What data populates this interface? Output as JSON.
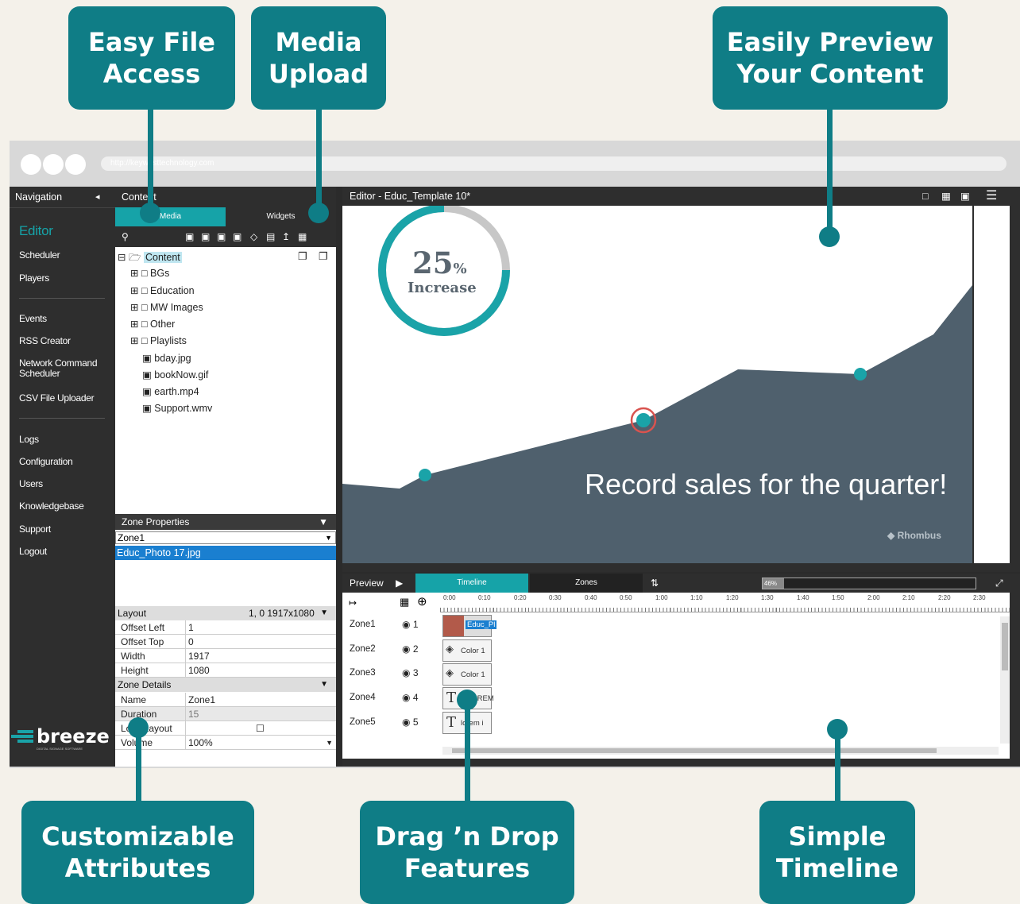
{
  "callouts": {
    "easy_file": "Easy File\nAccess",
    "media_upload": "Media\nUpload",
    "preview": "Easily Preview\nYour Content",
    "custom": "Customizable\nAttributes",
    "drag": "Drag ’n Drop\nFeatures",
    "timeline": "Simple\nTimeline"
  },
  "browser": {
    "url": "http://keywesttechnology.com"
  },
  "nav": {
    "title": "Navigation",
    "collapse": "◂",
    "items": [
      "Editor",
      "Scheduler",
      "Players",
      "Events",
      "RSS Creator",
      "Network Command Scheduler",
      "CSV File Uploader",
      "Logs",
      "Configuration",
      "Users",
      "Knowledgebase",
      "Support",
      "Logout"
    ],
    "logo": "breeze",
    "logo_sub": "DIGITAL SIGNAGE SOFTWARE"
  },
  "content": {
    "title": "Content",
    "tabs": [
      "Media",
      "Widgets"
    ],
    "tree": [
      {
        "label": "Content",
        "type": "root"
      },
      {
        "label": "BGs",
        "type": "folder"
      },
      {
        "label": "Education",
        "type": "folder"
      },
      {
        "label": "MW Images",
        "type": "folder"
      },
      {
        "label": "Other",
        "type": "folder"
      },
      {
        "label": "Playlists",
        "type": "folder"
      },
      {
        "label": "bday.jpg",
        "type": "file"
      },
      {
        "label": "bookNow.gif",
        "type": "file"
      },
      {
        "label": "earth.mp4",
        "type": "file"
      },
      {
        "label": "Support.wmv",
        "type": "file"
      }
    ],
    "zone_properties": "Zone Properties",
    "zone_select": "Zone1",
    "zone_file": "Educ_Photo 17.jpg",
    "layout_label": "Layout",
    "layout_info": "1, 0  1917x1080",
    "layout_rows": [
      {
        "k": "Offset Left",
        "v": "1"
      },
      {
        "k": "Offset Top",
        "v": "0"
      },
      {
        "k": "Width",
        "v": "1917"
      },
      {
        "k": "Height",
        "v": "1080"
      }
    ],
    "zone_details_label": "Zone Details",
    "zone_rows": [
      {
        "k": "Name",
        "v": "Zone1"
      },
      {
        "k": "Duration",
        "v": "15"
      },
      {
        "k": "Lock Layout",
        "v": "☐"
      },
      {
        "k": "Volume",
        "v": "100%"
      }
    ]
  },
  "editor": {
    "title": "Editor - Educ_Template 10*",
    "percent_num": "25",
    "percent_sign": "%",
    "increase": "Increase",
    "record": "Record sales for the quarter!",
    "brand": "Rhombus"
  },
  "timeline": {
    "preview": "Preview",
    "tab_timeline": "Timeline",
    "tab_zones": "Zones",
    "zoom": "46%",
    "ticks": [
      "0:00",
      "0:10",
      "0:20",
      "0:30",
      "0:40",
      "0:50",
      "1:00",
      "1:10",
      "1:20",
      "1:30",
      "1:40",
      "1:50",
      "2:00",
      "2:10",
      "2:20",
      "2:30"
    ],
    "zones": [
      {
        "name": "Zone1",
        "num": "1",
        "clip": "Educ_Pl"
      },
      {
        "name": "Zone2",
        "num": "2",
        "clip": "Color 1"
      },
      {
        "name": "Zone3",
        "num": "3",
        "clip": "Color 1"
      },
      {
        "name": "Zone4",
        "num": "4",
        "clip": "LOREM"
      },
      {
        "name": "Zone5",
        "num": "5",
        "clip": "lorem i"
      }
    ]
  },
  "chart_data": {
    "type": "area",
    "progress_fraction": 0.25,
    "color_area": "#4f606d",
    "color_accent": "#1aa3a8"
  }
}
